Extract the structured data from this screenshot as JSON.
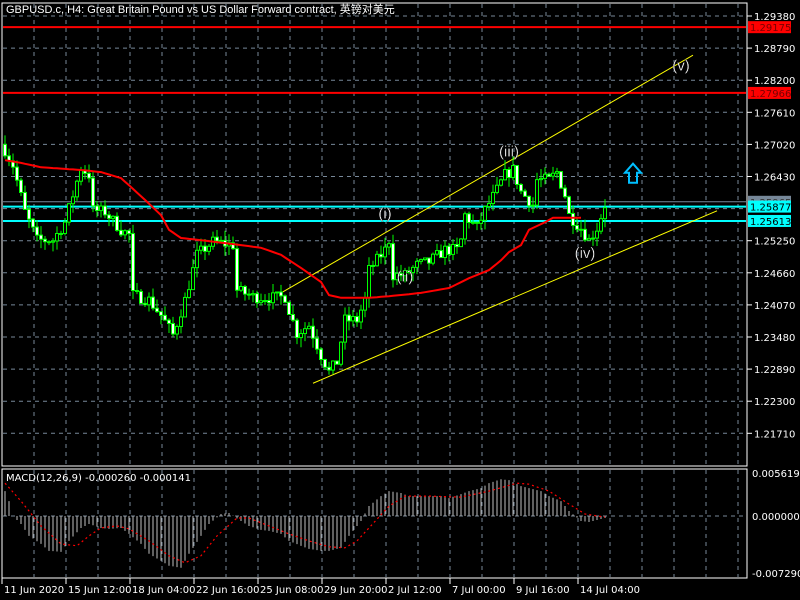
{
  "title": "GBPUSD.c, H4:  Great Britain Pound vs US Dollar Forward contract, 英镑对美元",
  "chart_data": {
    "type": "candlestick",
    "symbol": "GBPUSD.c",
    "timeframe": "H4",
    "price_axis": {
      "range": [
        1.2122,
        1.2986
      ],
      "ticks": [
        "1.29380",
        "1.28790",
        "1.28200",
        "1.27610",
        "1.27020",
        "1.26430",
        "1.25250",
        "1.24660",
        "1.24070",
        "1.23480",
        "1.22890",
        "1.22300",
        "1.21710"
      ],
      "grid_values": [
        1.2938,
        1.2879,
        1.282,
        1.2761,
        1.2702,
        1.2643,
        1.2584,
        1.2525,
        1.2466,
        1.2407,
        1.2348,
        1.2289,
        1.223,
        1.2171
      ]
    },
    "time_axis": {
      "ticks": [
        "11 Jun 2020",
        "15 Jun 12:00",
        "18 Jun 04:00",
        "22 Jun 16:00",
        "25 Jun 08:00",
        "29 Jun 20:00",
        "2 Jul 12:00",
        "7 Jul 00:00",
        "9 Jul 16:00",
        "14 Jul 04:00"
      ],
      "bar_count": 151
    },
    "close_anchors": [
      [
        0,
        1.2692
      ],
      [
        2,
        1.2664
      ],
      [
        5,
        1.2578
      ],
      [
        8,
        1.2526
      ],
      [
        12,
        1.2526
      ],
      [
        15,
        1.2559
      ],
      [
        17,
        1.2609
      ],
      [
        19,
        1.2659
      ],
      [
        21,
        1.2646
      ],
      [
        22,
        1.2581
      ],
      [
        25,
        1.2578
      ],
      [
        29,
        1.2545
      ],
      [
        31,
        1.2536
      ],
      [
        32,
        1.2425
      ],
      [
        36,
        1.2416
      ],
      [
        39,
        1.2388
      ],
      [
        42,
        1.2352
      ],
      [
        45,
        1.2416
      ],
      [
        48,
        1.2499
      ],
      [
        52,
        1.2523
      ],
      [
        57,
        1.2517
      ],
      [
        58,
        1.2434
      ],
      [
        62,
        1.2422
      ],
      [
        67,
        1.242
      ],
      [
        70,
        1.2422
      ],
      [
        71,
        1.2398
      ],
      [
        73,
        1.2355
      ],
      [
        76,
        1.237
      ],
      [
        79,
        1.2315
      ],
      [
        81,
        1.2284
      ],
      [
        83,
        1.2302
      ],
      [
        85,
        1.2379
      ],
      [
        88,
        1.2379
      ],
      [
        90,
        1.2416
      ],
      [
        91,
        1.2471
      ],
      [
        95,
        1.2508
      ],
      [
        96,
        1.2526
      ],
      [
        97,
        1.2462
      ],
      [
        100,
        1.2462
      ],
      [
        103,
        1.248
      ],
      [
        106,
        1.2486
      ],
      [
        110,
        1.2508
      ],
      [
        113,
        1.2508
      ],
      [
        114,
        1.2526
      ],
      [
        115,
        1.2572
      ],
      [
        118,
        1.2548
      ],
      [
        120,
        1.2581
      ],
      [
        123,
        1.2618
      ],
      [
        125,
        1.2646
      ],
      [
        127,
        1.2655
      ],
      [
        129,
        1.2615
      ],
      [
        132,
        1.2591
      ],
      [
        133,
        1.2637
      ],
      [
        136,
        1.2637
      ],
      [
        138,
        1.2651
      ],
      [
        140,
        1.2609
      ],
      [
        141,
        1.2572
      ],
      [
        144,
        1.2548
      ],
      [
        146,
        1.2526
      ],
      [
        148,
        1.2548
      ],
      [
        150,
        1.2591
      ]
    ],
    "moving_average": {
      "color": "#ff0000",
      "anchors": [
        [
          0,
          1.2673
        ],
        [
          4,
          1.2668
        ],
        [
          9,
          1.266
        ],
        [
          19,
          1.2655
        ],
        [
          24,
          1.2651
        ],
        [
          29,
          1.264
        ],
        [
          31,
          1.2627
        ],
        [
          35,
          1.26
        ],
        [
          39,
          1.2572
        ],
        [
          41,
          1.2545
        ],
        [
          44,
          1.253
        ],
        [
          49,
          1.2526
        ],
        [
          59,
          1.2517
        ],
        [
          64,
          1.2512
        ],
        [
          69,
          1.2499
        ],
        [
          74,
          1.2475
        ],
        [
          79,
          1.2449
        ],
        [
          81,
          1.2425
        ],
        [
          84,
          1.242
        ],
        [
          91,
          1.242
        ],
        [
          96,
          1.2423
        ],
        [
          104,
          1.2429
        ],
        [
          111,
          1.2438
        ],
        [
          116,
          1.2456
        ],
        [
          121,
          1.2471
        ],
        [
          124,
          1.2489
        ],
        [
          126,
          1.2504
        ],
        [
          129,
          1.2517
        ],
        [
          131,
          1.2545
        ],
        [
          135,
          1.2559
        ],
        [
          137,
          1.2567
        ],
        [
          144,
          1.2567
        ]
      ]
    },
    "horizontal_lines": [
      {
        "price": 1.29175,
        "label": "1.29175",
        "color": "#ff0000"
      },
      {
        "price": 1.27966,
        "label": "1.27966",
        "color": "#ff0000"
      },
      {
        "price": 1.25965,
        "label": "1.25965",
        "color": "#778899"
      },
      {
        "price": 1.25877,
        "label": "1.25877",
        "color": "#00ffff"
      },
      {
        "price": 1.25613,
        "label": "1.25613",
        "color": "#00ffff"
      }
    ],
    "channel": {
      "color": "#ffff00",
      "upper": [
        [
          69,
          1.2429
        ],
        [
          172,
          1.2866
        ]
      ],
      "lower": [
        [
          77,
          1.2263
        ],
        [
          178,
          1.258
        ]
      ]
    },
    "wave_labels": [
      {
        "text": "(i)",
        "bar": 95,
        "price": 1.2566
      },
      {
        "text": "(ii)",
        "bar": 100,
        "price": 1.245
      },
      {
        "text": "(iii)",
        "bar": 126,
        "price": 1.268
      },
      {
        "text": "(iv)",
        "bar": 145,
        "price": 1.2493
      },
      {
        "text": "(v)",
        "bar": 169,
        "price": 1.2838
      }
    ],
    "arrow": {
      "type": "up-arrow",
      "bar": 157,
      "price": 1.265,
      "color": "#00bfff"
    },
    "macd": {
      "label": "MACD(12,26,9) -0.000260 -0.000141",
      "params": [
        12,
        26,
        9
      ],
      "main": -0.00026,
      "signal_value": -0.000141,
      "axis_ticks": [
        "0.005619",
        "0.000000",
        "-0.007290"
      ],
      "range": [
        -0.00729,
        0.005619
      ],
      "histogram_anchors": [
        [
          0,
          0.00325
        ],
        [
          1,
          0.00195
        ],
        [
          2,
          0
        ],
        [
          4,
          -0.00104
        ],
        [
          6,
          -0.0026
        ],
        [
          9,
          -0.00364
        ],
        [
          11,
          -0.00455
        ],
        [
          14,
          -0.00468
        ],
        [
          16,
          -0.00325
        ],
        [
          19,
          -0.00156
        ],
        [
          21,
          -0.00104
        ],
        [
          24,
          -0.00156
        ],
        [
          26,
          -0.00169
        ],
        [
          29,
          -0.00156
        ],
        [
          31,
          -0.00234
        ],
        [
          34,
          -0.00364
        ],
        [
          36,
          -0.00494
        ],
        [
          39,
          -0.00585
        ],
        [
          41,
          -0.0065
        ],
        [
          44,
          -0.00676
        ],
        [
          46,
          -0.00494
        ],
        [
          49,
          -0.0026
        ],
        [
          51,
          -0.00104
        ],
        [
          54,
          0.00026
        ],
        [
          56,
          0.00039
        ],
        [
          59,
          -0.00065
        ],
        [
          61,
          -0.0013
        ],
        [
          64,
          -0.00182
        ],
        [
          66,
          -0.00195
        ],
        [
          69,
          -0.00234
        ],
        [
          71,
          -0.00325
        ],
        [
          74,
          -0.0039
        ],
        [
          76,
          -0.00429
        ],
        [
          79,
          -0.00455
        ],
        [
          81,
          -0.00455
        ],
        [
          84,
          -0.00416
        ],
        [
          86,
          -0.0026
        ],
        [
          89,
          -0.00065
        ],
        [
          91,
          0.0013
        ],
        [
          94,
          0.0026
        ],
        [
          96,
          0.00325
        ],
        [
          99,
          0.003
        ],
        [
          101,
          0.0026
        ],
        [
          104,
          0.0026
        ],
        [
          106,
          0.0026
        ],
        [
          109,
          0.0026
        ],
        [
          111,
          0.00234
        ],
        [
          114,
          0.00286
        ],
        [
          116,
          0.00325
        ],
        [
          119,
          0.00364
        ],
        [
          121,
          0.00429
        ],
        [
          124,
          0.00481
        ],
        [
          126,
          0.00468
        ],
        [
          129,
          0.0039
        ],
        [
          131,
          0.00364
        ],
        [
          134,
          0.00325
        ],
        [
          136,
          0.0026
        ],
        [
          139,
          0.00195
        ],
        [
          141,
          0.00065
        ],
        [
          144,
          -0.00065
        ],
        [
          146,
          -0.00078
        ],
        [
          149,
          -0.00039
        ],
        [
          150,
          -0.00026
        ]
      ],
      "signal_anchors": [
        [
          0,
          0.00429
        ],
        [
          4,
          0.00195
        ],
        [
          9,
          -0.0013
        ],
        [
          14,
          -0.00364
        ],
        [
          18,
          -0.0039
        ],
        [
          21,
          -0.0026
        ],
        [
          24,
          -0.00156
        ],
        [
          28,
          -0.0013
        ],
        [
          31,
          -0.00169
        ],
        [
          36,
          -0.00325
        ],
        [
          41,
          -0.0052
        ],
        [
          45,
          -0.00611
        ],
        [
          49,
          -0.0052
        ],
        [
          53,
          -0.0026
        ],
        [
          58,
          -0.00026
        ],
        [
          61,
          -0.00026
        ],
        [
          66,
          -0.0013
        ],
        [
          71,
          -0.00234
        ],
        [
          76,
          -0.00325
        ],
        [
          81,
          -0.00403
        ],
        [
          85,
          -0.00416
        ],
        [
          88,
          -0.00325
        ],
        [
          91,
          -0.00156
        ],
        [
          96,
          0.0013
        ],
        [
          100,
          0.0026
        ],
        [
          106,
          0.0026
        ],
        [
          114,
          0.00247
        ],
        [
          121,
          0.00325
        ],
        [
          128,
          0.00429
        ],
        [
          131,
          0.00416
        ],
        [
          136,
          0.00325
        ],
        [
          141,
          0.00156
        ],
        [
          145,
          0.00026
        ],
        [
          150,
          -0.000141
        ]
      ]
    }
  }
}
